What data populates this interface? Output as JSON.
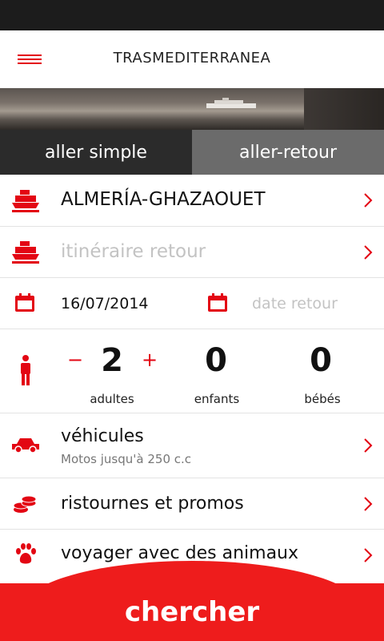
{
  "header": {
    "brand": "TRASMEDITERRANEA"
  },
  "trip_tabs": [
    {
      "label": "aller simple",
      "active": true
    },
    {
      "label": "aller-retour",
      "active": false
    }
  ],
  "route": {
    "outbound": "ALMERÍA-GHAZAOUET",
    "return_placeholder": "itinéraire retour"
  },
  "dates": {
    "outbound": "16/07/2014",
    "return_placeholder": "date retour"
  },
  "passengers": {
    "adults": {
      "count": "2",
      "label": "adultes",
      "minus": "−",
      "plus": "+"
    },
    "children": {
      "count": "0",
      "label": "enfants"
    },
    "infants": {
      "count": "0",
      "label": "bébés"
    }
  },
  "vehicles": {
    "title": "véhicules",
    "subtitle": "Motos jusqu'à 250 c.c"
  },
  "promos": {
    "title": "ristournes et promos"
  },
  "pets": {
    "title": "voyager avec des animaux"
  },
  "search": {
    "label": "chercher"
  },
  "colors": {
    "accent": "#e30613",
    "button": "#ee1c1c",
    "tab_active": "#2b2b2b",
    "tab_inactive": "#6b6b6b"
  },
  "icons": [
    "menu-icon",
    "ship-icon",
    "calendar-icon",
    "person-icon",
    "car-icon",
    "coins-icon",
    "paw-icon",
    "chevron-right-icon"
  ]
}
